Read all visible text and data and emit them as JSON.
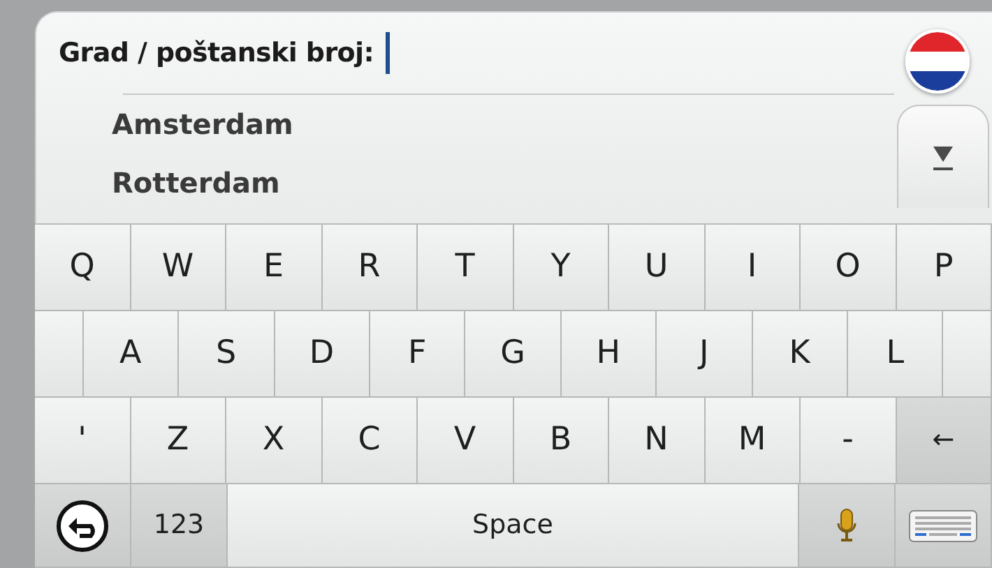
{
  "search": {
    "label": "Grad / poštanski broj:"
  },
  "suggestions": [
    {
      "text": "Amsterdam"
    },
    {
      "text": "Rotterdam"
    }
  ],
  "keyboard": {
    "rows": [
      [
        {
          "kind": "char",
          "label": "Q"
        },
        {
          "kind": "char",
          "label": "W"
        },
        {
          "kind": "char",
          "label": "E"
        },
        {
          "kind": "char",
          "label": "R"
        },
        {
          "kind": "char",
          "label": "T"
        },
        {
          "kind": "char",
          "label": "Y"
        },
        {
          "kind": "char",
          "label": "U"
        },
        {
          "kind": "char",
          "label": "I"
        },
        {
          "kind": "char",
          "label": "O"
        },
        {
          "kind": "char",
          "label": "P"
        }
      ],
      [
        {
          "kind": "spacer"
        },
        {
          "kind": "char",
          "label": "A"
        },
        {
          "kind": "char",
          "label": "S"
        },
        {
          "kind": "char",
          "label": "D"
        },
        {
          "kind": "char",
          "label": "F"
        },
        {
          "kind": "char",
          "label": "G"
        },
        {
          "kind": "char",
          "label": "H"
        },
        {
          "kind": "char",
          "label": "J"
        },
        {
          "kind": "char",
          "label": "K"
        },
        {
          "kind": "char",
          "label": "L"
        },
        {
          "kind": "spacer"
        }
      ],
      [
        {
          "kind": "char",
          "label": "'"
        },
        {
          "kind": "char",
          "label": "Z"
        },
        {
          "kind": "char",
          "label": "X"
        },
        {
          "kind": "char",
          "label": "C"
        },
        {
          "kind": "char",
          "label": "V"
        },
        {
          "kind": "char",
          "label": "B"
        },
        {
          "kind": "char",
          "label": "N"
        },
        {
          "kind": "char",
          "label": "M"
        },
        {
          "kind": "char",
          "label": "-"
        },
        {
          "kind": "function",
          "label": "←"
        }
      ],
      [
        {
          "kind": "back"
        },
        {
          "kind": "function",
          "label": "123"
        },
        {
          "kind": "space",
          "label": "Space"
        },
        {
          "kind": "mic"
        },
        {
          "kind": "layout"
        }
      ]
    ]
  }
}
